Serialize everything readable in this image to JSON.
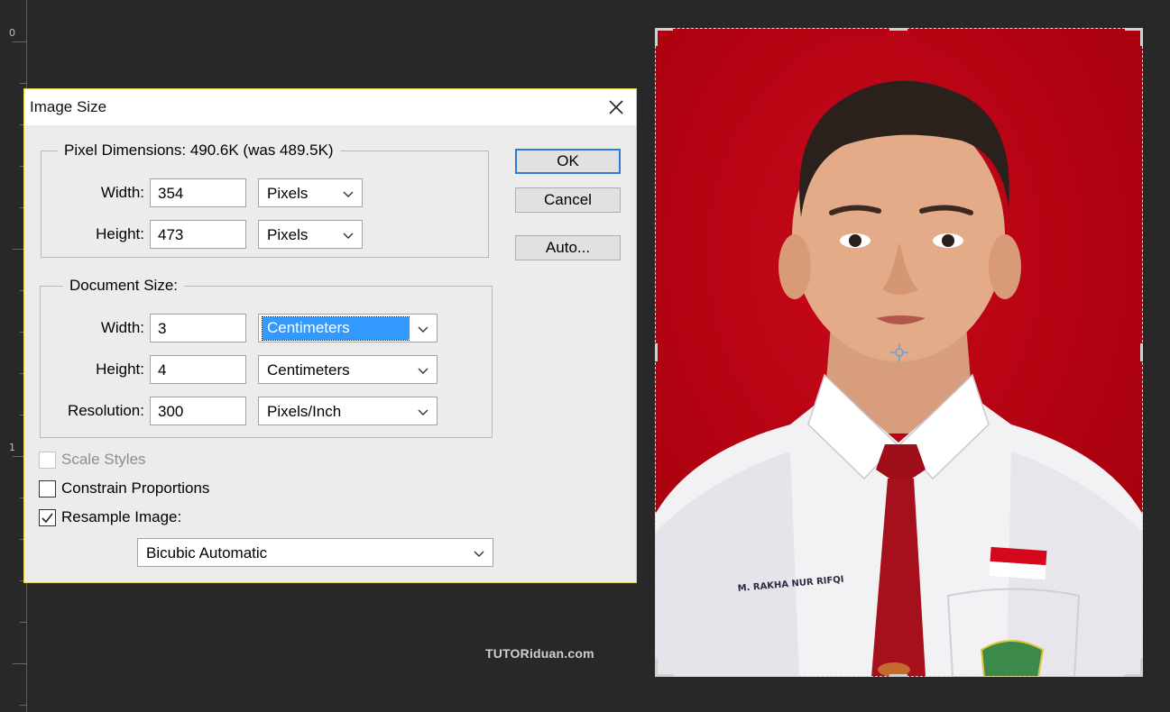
{
  "ruler": {
    "labels": [
      "0",
      "1"
    ]
  },
  "dialog": {
    "title": "Image Size",
    "pixel_dimensions": {
      "legend": "Pixel Dimensions:  490.6K (was 489.5K)",
      "width_label": "Width:",
      "width_value": "354",
      "width_unit": "Pixels",
      "height_label": "Height:",
      "height_value": "473",
      "height_unit": "Pixels"
    },
    "document_size": {
      "legend": "Document Size:",
      "width_label": "Width:",
      "width_value": "3",
      "width_unit": "Centimeters",
      "height_label": "Height:",
      "height_value": "4",
      "height_unit": "Centimeters",
      "resolution_label": "Resolution:",
      "resolution_value": "300",
      "resolution_unit": "Pixels/Inch"
    },
    "buttons": {
      "ok": "OK",
      "cancel": "Cancel",
      "auto": "Auto..."
    },
    "options": {
      "scale_styles": {
        "label": "Scale Styles",
        "checked": false,
        "enabled": false
      },
      "constrain_proportions": {
        "label": "Constrain Proportions",
        "checked": false,
        "enabled": true
      },
      "resample_image": {
        "label": "Resample Image:",
        "checked": true,
        "enabled": true
      }
    },
    "resample_method": "Bicubic Automatic"
  },
  "photo": {
    "background_color": "#b7000f",
    "name_tag": "M. RAKHA NUR RIFQI"
  },
  "watermark": "TUTORiduan.com",
  "colors": {
    "accent": "#3399ff",
    "dialog_bg": "#ececec",
    "canvas_bg": "#282828"
  }
}
